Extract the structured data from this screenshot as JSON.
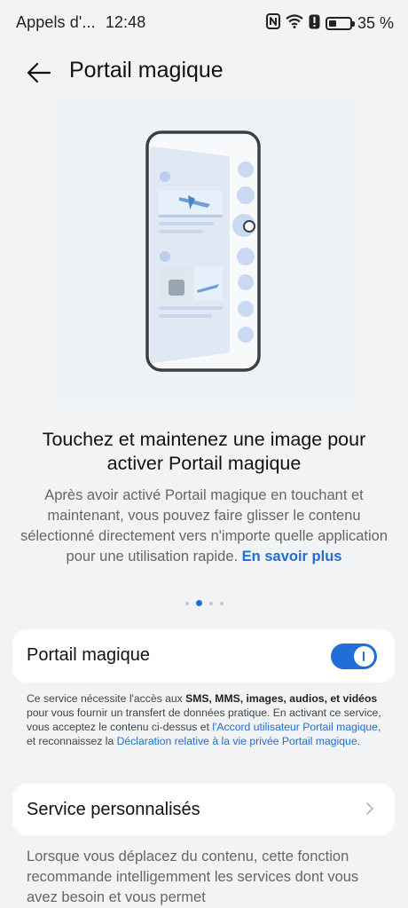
{
  "status_bar": {
    "carrier": "Appels d'...",
    "time": "12:48",
    "battery_percent": "35 %",
    "battery_level": 0.35,
    "icons": [
      "nfc-icon",
      "wifi-icon",
      "alert-icon",
      "battery-icon"
    ]
  },
  "header": {
    "title": "Portail magique",
    "back_icon": "arrow-left-icon"
  },
  "intro": {
    "headline": "Touchez et maintenez une image pour activer Portail magique",
    "description": "Après avoir activé Portail magique en touchant et maintenant, vous pouvez faire glisser le contenu sélectionné directement vers n'importe quelle application pour une utilisation rapide.",
    "learn_more": "En savoir plus"
  },
  "pager": {
    "count": 4,
    "active_index": 1
  },
  "toggle_card": {
    "label": "Portail magique",
    "enabled": true
  },
  "legal": {
    "t1": "Ce service nécessite l'accès aux ",
    "b1": "SMS, MMS, images, audios, et vidéos",
    "t2": " pour vous fournir un transfert de données pratique. En activant ce service, vous acceptez le contenu ci-dessus et ",
    "l1": "l'Accord utilisateur Portail magique",
    "t3": ", et reconnaissez la ",
    "l2": "Déclaration relative à la vie privée Portail magique",
    "t4": "."
  },
  "service_card": {
    "label": "Service personnalisés",
    "chevron_icon": "chevron-right-icon"
  },
  "service_description": "Lorsque vous déplacez du contenu, cette fonction recommande intelligemment les services dont vous avez besoin et vous permet",
  "colors": {
    "accent": "#1f6fd6",
    "background": "#f1f3f5",
    "card": "#ffffff"
  }
}
